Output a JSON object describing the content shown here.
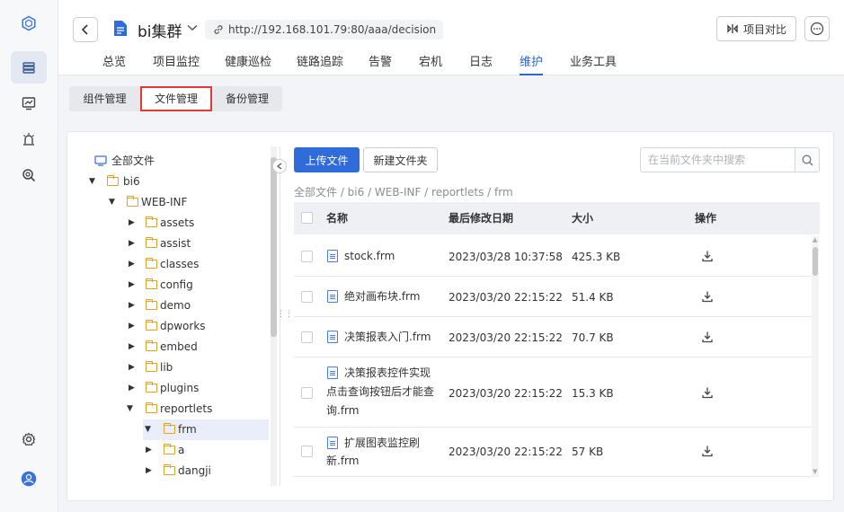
{
  "header": {
    "title": "bi集群",
    "url": "http://192.168.101.79:80/aaa/decision",
    "compare_label": "项目对比",
    "nav_tabs": [
      "总览",
      "项目监控",
      "健康巡检",
      "链路追踪",
      "告警",
      "宕机",
      "日志",
      "维护",
      "业务工具"
    ],
    "active_nav": "维护"
  },
  "subtabs": [
    "组件管理",
    "文件管理",
    "备份管理"
  ],
  "active_subtab": "文件管理",
  "tree": {
    "root": "全部文件",
    "items": [
      "bi6",
      "WEB-INF",
      "assets",
      "assist",
      "classes",
      "config",
      "demo",
      "dpworks",
      "embed",
      "lib",
      "plugins",
      "reportlets",
      "frm",
      "a",
      "dangji"
    ]
  },
  "toolbar": {
    "upload_label": "上传文件",
    "newfolder_label": "新建文件夹",
    "search_placeholder": "在当前文件夹中搜索"
  },
  "breadcrumb": "全部文件 / bi6 / WEB-INF / reportlets / frm",
  "table": {
    "headers": [
      "名称",
      "最后修改日期",
      "大小",
      "操作"
    ],
    "rows": [
      {
        "name_lines": [
          "stock.frm"
        ],
        "date": "2023/03/28 10:37:58",
        "size": "425.3 KB"
      },
      {
        "name_lines": [
          "绝对画布块.frm"
        ],
        "date": "2023/03/20 22:15:22",
        "size": "51.4 KB"
      },
      {
        "name_lines": [
          "决策报表入门.frm"
        ],
        "date": "2023/03/20 22:15:22",
        "size": "70.7 KB"
      },
      {
        "name_lines": [
          "决策报表控件实现",
          "点击查询按钮后才能查",
          "询.frm"
        ],
        "date": "2023/03/20 22:15:22",
        "size": "15.3 KB"
      },
      {
        "name_lines": [
          "扩展图表监控刷",
          "新.frm"
        ],
        "date": "2023/03/20 22:15:22",
        "size": "57 KB"
      }
    ]
  },
  "icons": [
    "logo-icon",
    "server-icon",
    "monitor-icon",
    "alarm-icon",
    "search-tool-icon",
    "settings-icon",
    "user-icon"
  ],
  "colors": {
    "accent": "#2a66d8",
    "highlight_border": "#e53935",
    "folder": "#e0a326"
  }
}
